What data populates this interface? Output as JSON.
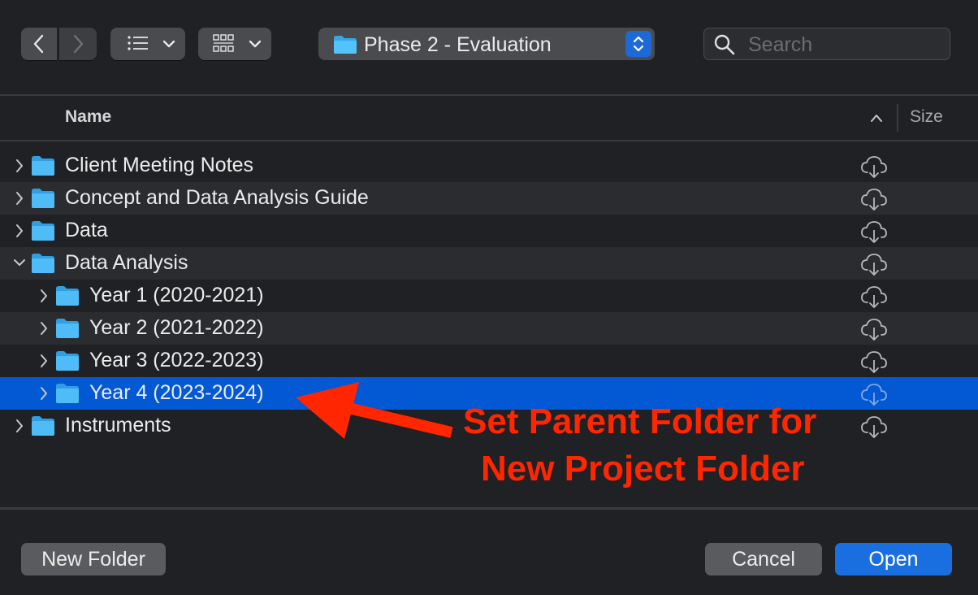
{
  "toolbar": {
    "path_title": "Phase 2 - Evaluation",
    "search_placeholder": "Search"
  },
  "columns": {
    "name": "Name",
    "size": "Size"
  },
  "rows": [
    {
      "label": "Client Meeting Notes",
      "level": 0,
      "expanded": false,
      "selected": false,
      "icon": "folder-icon",
      "status_icon": "icloud-download-icon"
    },
    {
      "label": "Concept and Data Analysis Guide",
      "level": 0,
      "expanded": false,
      "selected": false,
      "icon": "folder-icon",
      "status_icon": "icloud-download-icon"
    },
    {
      "label": "Data",
      "level": 0,
      "expanded": false,
      "selected": false,
      "icon": "folder-icon",
      "status_icon": "icloud-download-icon"
    },
    {
      "label": "Data Analysis",
      "level": 0,
      "expanded": true,
      "selected": false,
      "icon": "folder-icon",
      "status_icon": "icloud-download-icon"
    },
    {
      "label": "Year 1 (2020-2021)",
      "level": 1,
      "expanded": false,
      "selected": false,
      "icon": "folder-icon",
      "status_icon": "icloud-download-icon"
    },
    {
      "label": "Year 2 (2021-2022)",
      "level": 1,
      "expanded": false,
      "selected": false,
      "icon": "folder-icon",
      "status_icon": "icloud-download-icon"
    },
    {
      "label": "Year 3 (2022-2023)",
      "level": 1,
      "expanded": false,
      "selected": false,
      "icon": "folder-icon",
      "status_icon": "icloud-download-icon"
    },
    {
      "label": "Year 4 (2023-2024)",
      "level": 1,
      "expanded": false,
      "selected": true,
      "icon": "folder-icon",
      "status_icon": "icloud-download-icon"
    },
    {
      "label": "Instruments",
      "level": 0,
      "expanded": false,
      "selected": false,
      "icon": "folder-icon",
      "status_icon": "icloud-download-icon"
    }
  ],
  "footer": {
    "new_folder": "New Folder",
    "cancel": "Cancel",
    "open": "Open"
  },
  "annotation": {
    "line1": "Set Parent Folder for",
    "line2": "New Project Folder",
    "color": "#ff2600"
  },
  "colors": {
    "accent": "#0358d4",
    "background": "#1f2124"
  }
}
